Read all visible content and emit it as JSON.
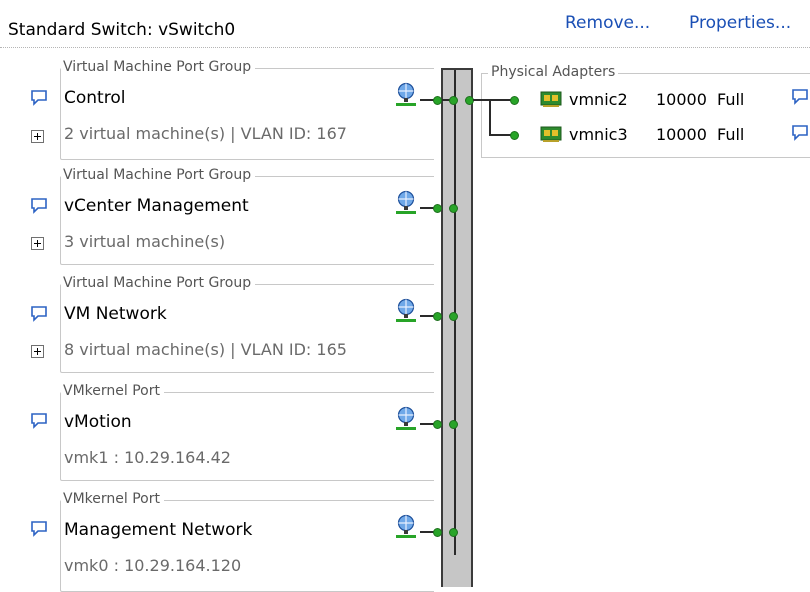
{
  "header": {
    "title": "Standard Switch: vSwitch0",
    "remove_label": "Remove...",
    "properties_label": "Properties..."
  },
  "port_groups": [
    {
      "type": "Virtual Machine Port Group",
      "name": "Control",
      "detail": "2 virtual machine(s) | VLAN ID: 167",
      "expandable": true
    },
    {
      "type": "Virtual Machine Port Group",
      "name": "vCenter Management",
      "detail": "3 virtual machine(s)",
      "expandable": true
    },
    {
      "type": "Virtual Machine Port Group",
      "name": "VM Network",
      "detail": "8 virtual machine(s) | VLAN ID: 165",
      "expandable": true
    },
    {
      "type": "VMkernel Port",
      "name": "vMotion",
      "detail": "vmk1 : 10.29.164.42",
      "expandable": false
    },
    {
      "type": "VMkernel Port",
      "name": "Management Network",
      "detail": "vmk0 : 10.29.164.120",
      "expandable": false
    }
  ],
  "physical_adapters": {
    "legend": "Physical Adapters",
    "nics": [
      {
        "name": "vmnic2",
        "speed": "10000",
        "duplex": "Full"
      },
      {
        "name": "vmnic3",
        "speed": "10000",
        "duplex": "Full"
      }
    ]
  },
  "icons": {
    "info": "speech-bubble-icon",
    "expand": "plus-expander-icon",
    "port_group": "network-globe-icon",
    "nic": "network-card-icon"
  },
  "colors": {
    "link": "#1a4fb5",
    "connector_dot": "#28a428",
    "bus_fill": "#c6c6c6",
    "info_icon": "#2d63c4"
  }
}
